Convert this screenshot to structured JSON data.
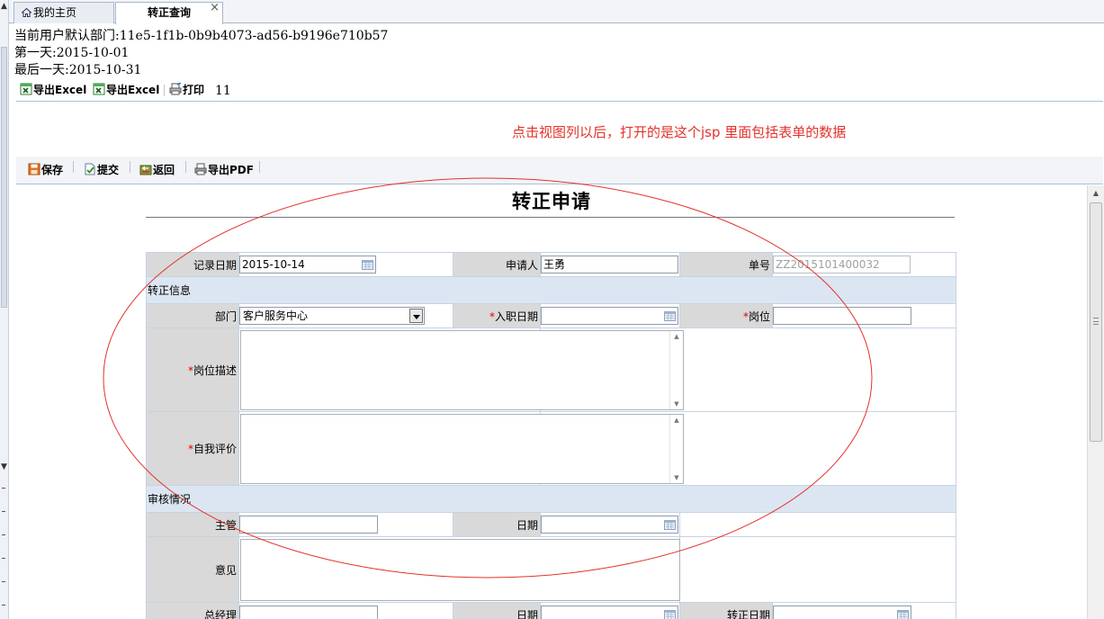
{
  "tabs": [
    {
      "label": "我的主页",
      "icon": "home-icon"
    },
    {
      "label": "转正查询",
      "close": "×"
    }
  ],
  "info": {
    "line1": "当前用户默认部门:11e5-1f1b-0b9b4073-ad56-b9196e710b57",
    "line2": "第一天:2015-10-01",
    "line3": "最后一天:2015-10-31"
  },
  "toolbar1": {
    "export_excel_1": "导出Excel",
    "export_excel_2": "导出Excel",
    "print": "打印",
    "count": "11"
  },
  "annotation": "点击视图列以后，打开的是这个jsp 里面包括表单的数据",
  "toolbar2": {
    "save": "保存",
    "submit": "提交",
    "back": "返回",
    "export_pdf": "导出PDF"
  },
  "form": {
    "title": "转正申请",
    "record_date_label": "记录日期",
    "record_date_value": "2015-10-14",
    "applicant_label": "申请人",
    "applicant_value": "王勇",
    "number_label": "单号",
    "number_value": "ZZ2015101400032",
    "section_info": "转正信息",
    "dept_label": "部门",
    "dept_value": "客户服务中心",
    "entry_date_label": "入职日期",
    "position_label": "岗位",
    "job_desc_label": "岗位描述",
    "self_eval_label": "自我评价",
    "section_review": "审核情况",
    "supervisor_label": "主管",
    "date_label": "日期",
    "opinion_label": "意见",
    "gm_label": "总经理",
    "gm_date_label": "日期",
    "confirm_date_label": "转正日期",
    "required_mark": "*"
  },
  "colors": {
    "annotation": "#e4322b",
    "label_bg": "#d9d9d9",
    "section_bg": "#dce6f2",
    "required": "#e00000"
  }
}
